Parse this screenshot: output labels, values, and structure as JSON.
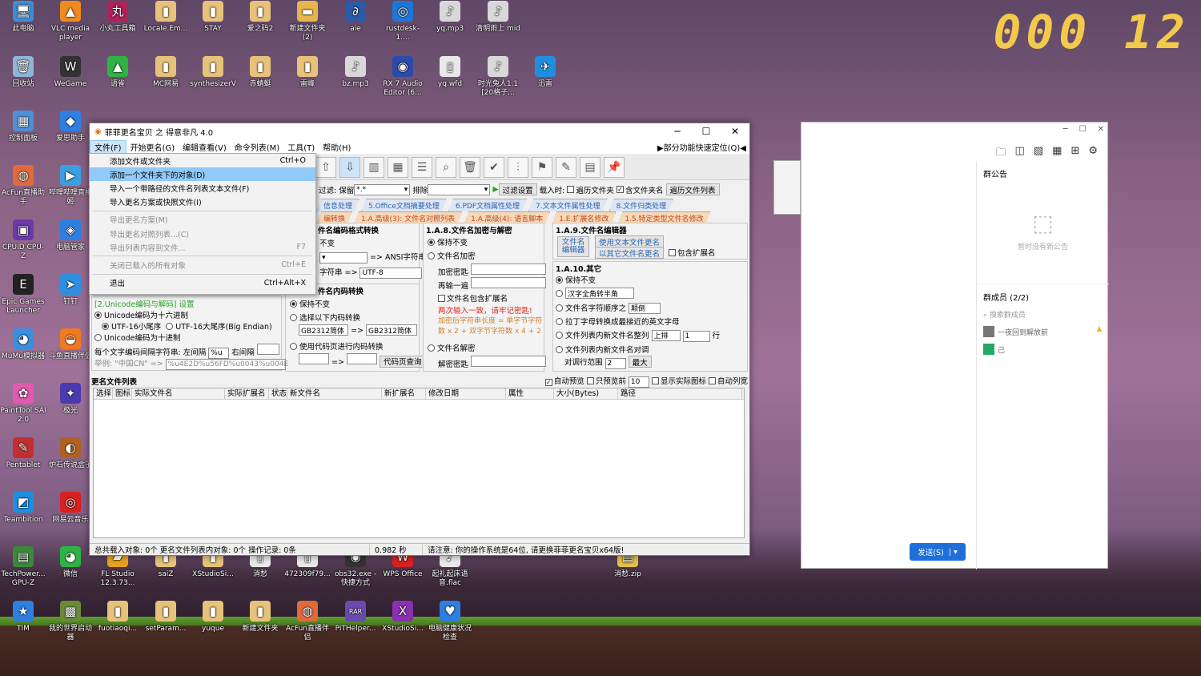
{
  "clock": "000 12",
  "desktop_icons": [
    {
      "label": "此电脑",
      "color": "#3c8fd6",
      "glyph": "🖥"
    },
    {
      "label": "VLC media player",
      "color": "#f08a1d",
      "glyph": "▲"
    },
    {
      "label": "小丸工具箱",
      "color": "#b0215a",
      "glyph": "丸"
    },
    {
      "label": "Locale.Em...",
      "color": "#e7c27a",
      "glyph": "▮"
    },
    {
      "label": "STAY",
      "color": "#e7c27a",
      "glyph": "▮"
    },
    {
      "label": "爱之码2",
      "color": "#e7c27a",
      "glyph": "▮"
    },
    {
      "label": "新建文件夹 (2)",
      "color": "#e8b54a",
      "glyph": "▬"
    },
    {
      "label": "aie",
      "color": "#2a5aa8",
      "glyph": "∂"
    },
    {
      "label": "rustdesk-1....",
      "color": "#1e77d6",
      "glyph": "◎"
    },
    {
      "label": "yq.mp3",
      "color": "#d8d8d8",
      "glyph": "♪"
    },
    {
      "label": "清明雨上 mid",
      "color": "#d8d8d8",
      "glyph": "♪"
    },
    {
      "label": "回收站",
      "color": "#8fb5d8",
      "glyph": "🗑"
    },
    {
      "label": "WeGame",
      "color": "#333",
      "glyph": "W"
    },
    {
      "label": "语雀",
      "color": "#2fb344",
      "glyph": "▲"
    },
    {
      "label": "MC网易",
      "color": "#e7c27a",
      "glyph": "▮"
    },
    {
      "label": "synthesizerV",
      "color": "#e7c27a",
      "glyph": "▮"
    },
    {
      "label": "赤蜻蜓",
      "color": "#e7c27a",
      "glyph": "▮"
    },
    {
      "label": "雷峰",
      "color": "#e7c27a",
      "glyph": "▮"
    },
    {
      "label": "bz.mp3",
      "color": "#d8d8d8",
      "glyph": "♪"
    },
    {
      "label": "RX 7 Audio Editor (6...",
      "color": "#2c4aa8",
      "glyph": "◉"
    },
    {
      "label": "yq.wfd",
      "color": "#e8e8e8",
      "glyph": "▯"
    },
    {
      "label": "时光兔人1.1 [20格子...",
      "color": "#d8d8d8",
      "glyph": "♪"
    },
    {
      "label": "迅雷",
      "color": "#1e8fe0",
      "glyph": "✈"
    },
    {
      "label": "控制面板",
      "color": "#4e8fd6",
      "glyph": "▦"
    },
    {
      "label": "爱思助手",
      "color": "#2e7fe0",
      "glyph": "◆"
    },
    {
      "label": "AcFun直播助手",
      "color": "#e06a3a",
      "glyph": "◍"
    },
    {
      "label": "哔哩哔哩直播姬",
      "color": "#3aa0e0",
      "glyph": "▶"
    },
    {
      "label": "CPUID CPU-Z",
      "color": "#6a3aa8",
      "glyph": "▣"
    },
    {
      "label": "电脑管家",
      "color": "#2e7fe0",
      "glyph": "◈"
    },
    {
      "label": "Epic Games Launcher",
      "color": "#222",
      "glyph": "E"
    },
    {
      "label": "钉钉",
      "color": "#2e8fe0",
      "glyph": "➤"
    },
    {
      "label": "MuMu模拟器",
      "color": "#3a8fe0",
      "glyph": "◕"
    },
    {
      "label": "斗鱼直播伴侣",
      "color": "#f07a20",
      "glyph": "◒"
    },
    {
      "label": "PaintTool SAI 2.0",
      "color": "#e05ab0",
      "glyph": "✿"
    },
    {
      "label": "极光",
      "color": "#4a3ab0",
      "glyph": "✦"
    },
    {
      "label": "Pentablet",
      "color": "#c03030",
      "glyph": "✎"
    },
    {
      "label": "炉石传说盒子",
      "color": "#b06020",
      "glyph": "◐"
    },
    {
      "label": "Teambition",
      "color": "#1e8fe0",
      "glyph": "◩"
    },
    {
      "label": "网易云音乐",
      "color": "#d82020",
      "glyph": "◎"
    },
    {
      "label": "TechPower... GPU-Z",
      "color": "#3a8a3a",
      "glyph": "▤"
    },
    {
      "label": "微信",
      "color": "#2fb344",
      "glyph": "◕"
    },
    {
      "label": "FL Studio 12.3.73...",
      "color": "#e8a020",
      "glyph": "▰"
    },
    {
      "label": "saiZ",
      "color": "#e7c27a",
      "glyph": "▮"
    },
    {
      "label": "XStudioSi...",
      "color": "#e7c27a",
      "glyph": "▮"
    },
    {
      "label": "消愁",
      "color": "#e8e8e8",
      "glyph": "▯"
    },
    {
      "label": "472309f79...",
      "color": "#e8e8e8",
      "glyph": "▯"
    },
    {
      "label": "obs32.exe - 快捷方式",
      "color": "#333",
      "glyph": "◉"
    },
    {
      "label": "WPS Office",
      "color": "#d82020",
      "glyph": "W"
    },
    {
      "label": "起礼起床语音.flac",
      "color": "#e8e8e8",
      "glyph": "♪"
    },
    {
      "label": "消愁.zip",
      "color": "#e8c040",
      "glyph": "▤"
    },
    {
      "label": "TIM",
      "color": "#2e7fe0",
      "glyph": "★"
    },
    {
      "label": "我的世界启动器",
      "color": "#6a8a3a",
      "glyph": "▩"
    },
    {
      "label": "fuotiaoqi...",
      "color": "#e7c27a",
      "glyph": "▮"
    },
    {
      "label": "setParam...",
      "color": "#e7c27a",
      "glyph": "▮"
    },
    {
      "label": "yuque",
      "color": "#e7c27a",
      "glyph": "▮"
    },
    {
      "label": "新建文件夹",
      "color": "#e7c27a",
      "glyph": "▮"
    },
    {
      "label": "AcFun直播伴侣",
      "color": "#e06a3a",
      "glyph": "◍"
    },
    {
      "label": "PiTHelper...",
      "color": "#6a4ab0",
      "glyph": "RAR"
    },
    {
      "label": "XStudioSi...",
      "color": "#8a30b0",
      "glyph": "X"
    },
    {
      "label": "电脑健康状况检查",
      "color": "#2e7fe0",
      "glyph": "♥"
    }
  ],
  "window": {
    "title": "菲菲更名宝贝 之 得意非凡 4.0",
    "controls": {
      "minimize": "─",
      "maximize": "☐",
      "close": "✕"
    },
    "menu": [
      "文件(F)",
      "开始更名(G)",
      "编辑查看(V)",
      "命令列表(M)",
      "工具(T)",
      "帮助(H)"
    ],
    "menu_right": "▶部分功能快速定位(Q)◀",
    "filter": {
      "label": "过滤: 保留",
      "value": "*.*",
      "exclude": "排除",
      "btn": "过滤设置",
      "load": "载入时:",
      "cb1": "遍历文件夹",
      "cb2": "含文件夹名",
      "btn2": "遍历文件列表"
    },
    "tabs_blue": [
      "信息处理",
      "5.Office文档摘要处理",
      "6.PDF文档属性处理",
      "7.文本文件属性处理",
      "8.文件归类处理"
    ],
    "tabs_orange": [
      "编转换",
      "1.A.高级(3): 文件名对照列表",
      "1.A.高级(4): 语言脚本",
      "1.E.扩展名修改",
      "1.5.特定类型文件名修改"
    ],
    "p1": {
      "title": "件名编码格式转换",
      "keep": "不变",
      "to_ansi": "=> ANSI字符串",
      "charset_label": "字符串 =>",
      "charset": "UTF-8"
    },
    "p2": {
      "title": "件名内码转换",
      "keep": "保持不变",
      "select": "选择以下内码转换",
      "from": "GB2312简体",
      "to": "GB2312简体",
      "code": "使用代码页进行内码转换",
      "btn": "代码页查询"
    },
    "p3": {
      "title": "1.A.8.文件名加密与解密",
      "keep": "保持不变",
      "enc": "文件名加密",
      "pwd": "加密密匙",
      "again": "再输一遍",
      "inc_ext": "文件名包含扩展名",
      "warn": "两次输入一致，请牢记密匙!",
      "note": "加密后字符串长度 = 单字节字符数 x 2 + 双字节字符数 x 4 + 2",
      "dec": "文件名解密",
      "dpwd": "解密密匙"
    },
    "p4": {
      "title": "1.A.9.文件名编辑器",
      "btn_big": "文件名编辑器",
      "btn1": "使用文本文件更名",
      "btn2": "以其它文件名更名",
      "inc_ext": "包含扩展名"
    },
    "p5": {
      "title": "1.A.10.其它",
      "keep": "保持不变",
      "fw": "汉字全角转半角",
      "order": "文件名字符顺序之",
      "order_v": "颠倒",
      "latin": "拉丁字母转换成最接近的英文字母",
      "align": "文件列表内新文件名整列",
      "align_v": "上排",
      "n": "1",
      "row": "行",
      "swap": "文件列表内新文件名对调",
      "range": "对调行范围",
      "range_v": "2",
      "max": "最大"
    },
    "p6": {
      "title": "[2.Unicode编码与解码] 设置",
      "hex": "Unicode编码为十六进制",
      "le": "UTF-16小尾序",
      "be": "UTF-16大尾序(Big Endian)",
      "dec": "Unicode编码为十进制",
      "sep": "每个文字编码间隔字符串: 左间隔",
      "sep_l": "%u",
      "sep_r": "右间隔",
      "ex_label": "举例: \"中国CN\" =>",
      "ex": "%u4E2D%u56FD%u0043%u004E"
    },
    "list": {
      "title": "更名文件列表",
      "auto": "自动预览",
      "only": "只预览前",
      "only_n": "10",
      "show_icon": "显示实际图标",
      "auto_col": "自动列宽",
      "cols": [
        "选择",
        "图标",
        "实际文件名",
        "实际扩展名",
        "状态",
        "新文件名",
        "新扩展名",
        "修改日期",
        "属性",
        "大小(Bytes)",
        "路径"
      ]
    },
    "status": [
      "总共载入对象: 0个  更名文件列表内对象: 0个  操作记录: 0条",
      "0.982 秒",
      "请注意: 你的操作系统是64位, 请更换菲菲更名宝贝x64版!"
    ]
  },
  "file_menu": [
    {
      "label": "添加文件或文件夹",
      "shortcut": "Ctrl+O",
      "state": "normal"
    },
    {
      "label": "添加一个文件夹下的对象(D)",
      "shortcut": "",
      "state": "highlight"
    },
    {
      "label": "导入一个带路径的文件名列表文本文件(F)",
      "shortcut": "",
      "state": "normal"
    },
    {
      "label": "导入更名方案或快照文件(I)",
      "shortcut": "",
      "state": "normal"
    },
    {
      "sep": true
    },
    {
      "label": "导出更名方案(M)",
      "shortcut": "",
      "state": "disabled"
    },
    {
      "label": "导出更名对照列表...(C)",
      "shortcut": "",
      "state": "disabled"
    },
    {
      "label": "导出列表内容到文件...",
      "shortcut": "F7",
      "state": "disabled"
    },
    {
      "sep": true
    },
    {
      "label": "关闭已载入的所有对象",
      "shortcut": "Ctrl+E",
      "state": "disabled"
    },
    {
      "sep": true
    },
    {
      "label": "退出",
      "shortcut": "Ctrl+Alt+X",
      "state": "normal"
    }
  ],
  "chat": {
    "announce": "群公告",
    "no_announce": "暂时没有新公告",
    "members": "群成员 (2/2)",
    "search": "搜索群成员",
    "m1": "一夜回到解放前",
    "m2": "己",
    "send": "发送(S)"
  }
}
